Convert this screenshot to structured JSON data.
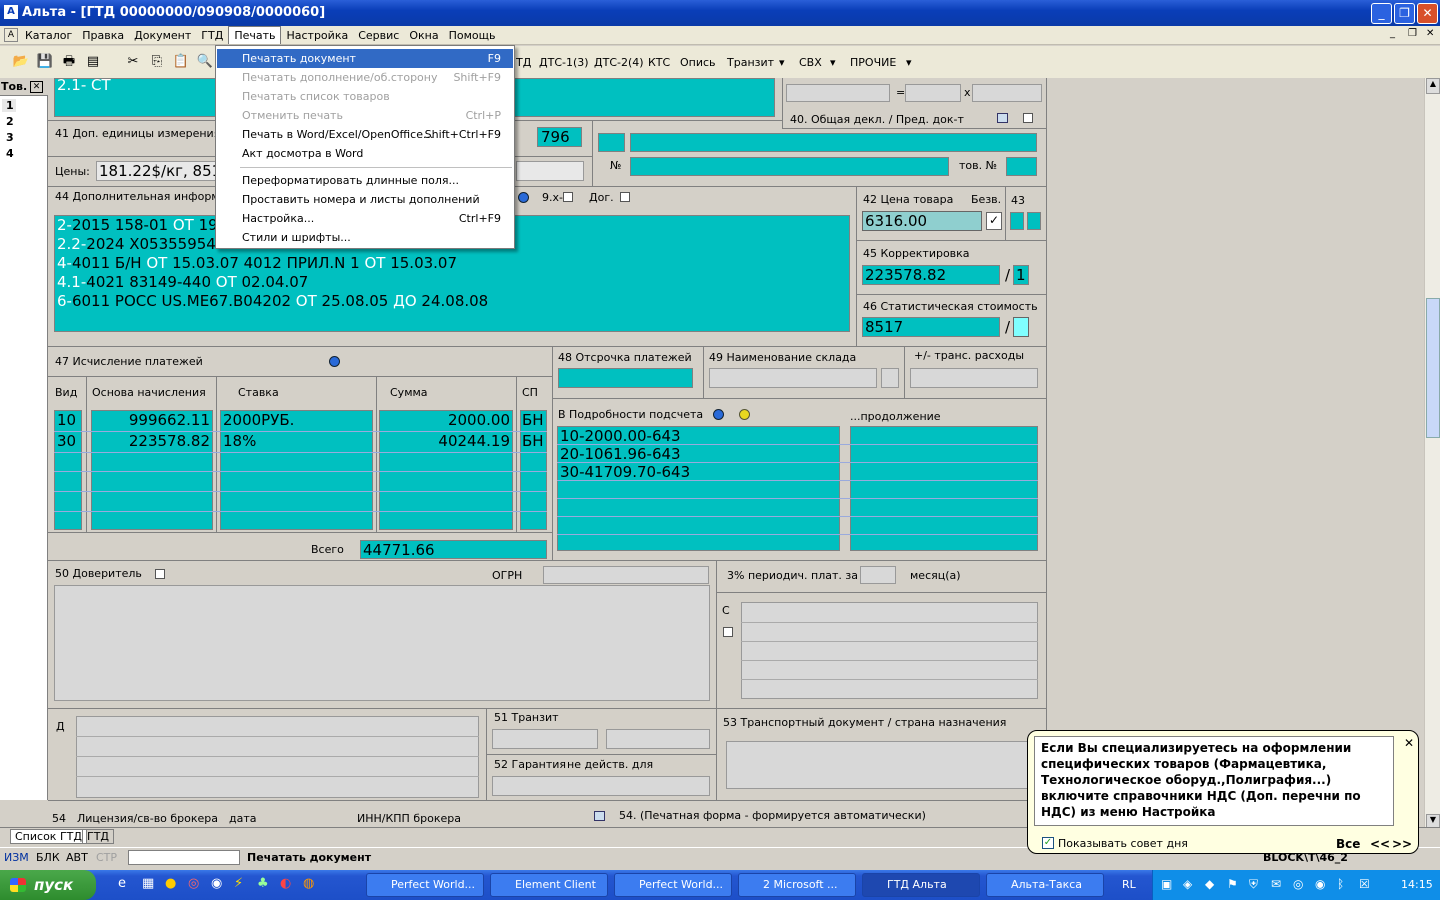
{
  "window": {
    "title": "Альта - [ГТД 00000000/090908/0000060]"
  },
  "menu": [
    "Каталог",
    "Правка",
    "Документ",
    "ГТД",
    "Печать",
    "Настройка",
    "Сервис",
    "Окна",
    "Помощь"
  ],
  "toolbar_tabs": [
    "ТД",
    "ДТС-1(3)",
    "ДТС-2(4)",
    "КТС",
    "Опись",
    "Транзит",
    "СВХ",
    "ПРОЧИЕ"
  ],
  "print_menu": [
    {
      "label": "Печатать документ",
      "shortcut": "F9",
      "state": "hl"
    },
    {
      "label": "Печатать дополнение/об.сторону",
      "shortcut": "Shift+F9",
      "state": "disabled"
    },
    {
      "label": "Печатать список товаров",
      "shortcut": "",
      "state": "disabled"
    },
    {
      "label": "Отменить печать",
      "shortcut": "Ctrl+P",
      "state": "disabled"
    },
    {
      "label": "Печать в Word/Excel/OpenOffice...",
      "shortcut": "Shift+Ctrl+F9",
      "state": ""
    },
    {
      "label": "Акт досмотра в Word",
      "shortcut": "",
      "state": ""
    },
    {
      "label": "Переформатировать длинные поля...",
      "shortcut": "",
      "state": ""
    },
    {
      "label": "Проставить номера и листы дополнений",
      "shortcut": "",
      "state": ""
    },
    {
      "label": "Настройка...",
      "shortcut": "Ctrl+F9",
      "state": ""
    },
    {
      "label": "Стили и шрифты...",
      "shortcut": "",
      "state": ""
    }
  ],
  "goods_panel": {
    "title": "Тов.",
    "items": [
      "1",
      "2",
      "3",
      "4"
    ]
  },
  "field31": {
    "label": "2.1- СТ"
  },
  "field41": {
    "label": "41 Доп. единицы измерения",
    "value": "796"
  },
  "prices": {
    "label": "Цены:",
    "value": "181.22$/кг, 851"
  },
  "field40": {
    "label": "40. Общая декл. / Пред. док-т",
    "no_label": "№",
    "tov_label": "тов. №",
    "eq": "=",
    "x": "x"
  },
  "field44": {
    "label": "44 Дополнительная информаци",
    "nine": "9.х-",
    "dog": "Дог.",
    "lines": [
      {
        "pre": "2-",
        "text": "2015 158-01 ",
        "ot": "ОТ",
        "rest": " 19.0"
      },
      {
        "pre": "2.2-",
        "text": "2024 X053559542",
        "ot": "",
        "rest": ""
      },
      {
        "pre": "4-",
        "text": "4011 Б/Н ",
        "ot": "ОТ",
        "rest": " 15.03.07 4012 ПРИЛ.N  1 ",
        "ot2": "ОТ",
        "rest2": " 15.03.07"
      },
      {
        "pre": "4.1-",
        "text": "4021 83149-440 ",
        "ot": "ОТ",
        "rest": " 02.04.07"
      },
      {
        "pre": "6-",
        "text": "6011 РОСС US.ME67.B04202 ",
        "ot": "ОТ",
        "rest": " 25.08.05 ",
        "ot2": "ДО",
        "rest2": " 24.08.08"
      }
    ]
  },
  "field42": {
    "label": "42 Цена товара",
    "bezv": "Безв.",
    "value": "6316.00",
    "check": "✓",
    "n43": "43"
  },
  "field45": {
    "label": "45 Корректировка",
    "value": "223578.82",
    "slash": "/",
    "after": "1"
  },
  "field46": {
    "label": "46 Статистическая стоимость",
    "value": "8517",
    "slash": "/"
  },
  "field47": {
    "label": "47 Исчисление платежей",
    "cols": [
      "Вид",
      "Основа начисления",
      "Ставка",
      "Сумма",
      "СП"
    ],
    "rows": [
      [
        "10",
        "999662.11",
        "2000РУБ.",
        "2000.00",
        "БН"
      ],
      [
        "30",
        "223578.82",
        "18%",
        "40244.19",
        "БН"
      ]
    ],
    "total_label": "Всего",
    "total": "44771.66"
  },
  "field48": {
    "label": "48 Отсрочка платежей"
  },
  "field49": {
    "label": "49 Наименование склада"
  },
  "trans": {
    "label": "+/-  транс. расходы"
  },
  "fieldB": {
    "label": "В Подробности подсчета",
    "cont": "...продолжение",
    "lines": [
      "10-2000.00-643",
      "20-1061.96-643",
      "30-41709.70-643"
    ]
  },
  "field50": {
    "label": "50 Доверитель",
    "ogrn": "ОГРН"
  },
  "periodic": {
    "label": "3% периодич. плат. за",
    "month": "месяц(а)"
  },
  "fieldC": {
    "label": "С"
  },
  "fieldD": {
    "label": "Д"
  },
  "field51": {
    "label": "51 Транзит"
  },
  "field52": {
    "label": "52 Гарантия",
    "sub": "не действ. для"
  },
  "field53": {
    "label": "53 Транспортный документ / страна назначения"
  },
  "field54": {
    "label": "54",
    "lic": "Лицензия/св-во брокера",
    "date": "дата",
    "inn": "ИНН/КПП брокера",
    "printform": "54. (Печатная форма - формируется автоматически)"
  },
  "bottom_tabs": [
    "Список ГТД",
    "ГТД"
  ],
  "status": {
    "items": [
      "ИЗМ",
      "БЛК",
      "АВТ",
      "СТР"
    ],
    "message": "Печатать документ",
    "block": "BLOCK\\T\\46_2"
  },
  "tip": {
    "text": "Если Вы специализируетесь на оформлении специфических товаров (Фармацевтика, Технологическое оборуд.,Полиграфия...) включите справочники НДС (Доп. перечни по НДС) из меню Настройка",
    "show": "Показывать совет дня",
    "all": "Все",
    "prev": "<<",
    "next": ">>",
    "close": "✕"
  },
  "taskbar": {
    "start": "пуск",
    "tasks": [
      "Perfect World...",
      "Element Client",
      "Perfect World...",
      "2 Microsoft ...",
      "ГТД Альта",
      "Альта-Такса"
    ],
    "lang": "RL",
    "clock": "14:15"
  }
}
